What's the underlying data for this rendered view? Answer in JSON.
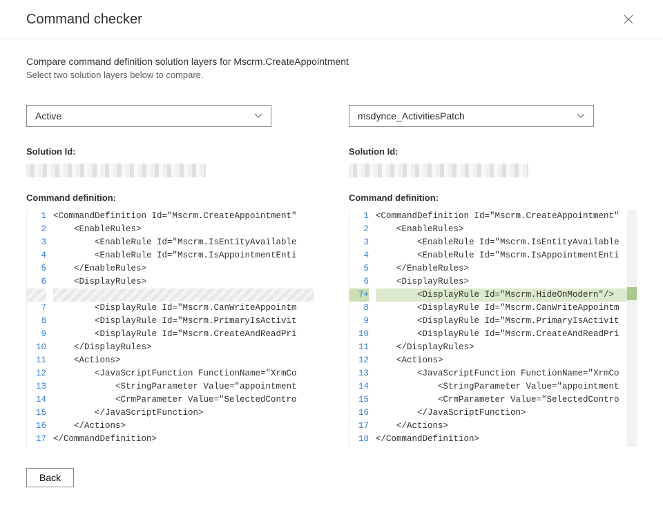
{
  "header": {
    "title": "Command checker"
  },
  "main": {
    "subtitle": "Compare command definition solution layers for Mscrm.CreateAppointment",
    "description": "Select two solution layers below to compare."
  },
  "labels": {
    "solution_id": "Solution Id:",
    "command_definition": "Command definition:"
  },
  "left": {
    "dropdown": "Active",
    "lines": [
      {
        "num": "1",
        "text": "<CommandDefinition Id=\"Mscrm.CreateAppointment\"",
        "type": "normal"
      },
      {
        "num": "2",
        "text": "    <EnableRules>",
        "type": "normal"
      },
      {
        "num": "3",
        "text": "        <EnableRule Id=\"Mscrm.IsEntityAvailable",
        "type": "normal"
      },
      {
        "num": "4",
        "text": "        <EnableRule Id=\"Mscrm.IsAppointmentEnti",
        "type": "normal"
      },
      {
        "num": "5",
        "text": "    </EnableRules>",
        "type": "normal"
      },
      {
        "num": "6",
        "text": "    <DisplayRules>",
        "type": "normal"
      },
      {
        "num": "",
        "text": "",
        "type": "hatched"
      },
      {
        "num": "7",
        "text": "        <DisplayRule Id=\"Mscrm.CanWriteAppointm",
        "type": "normal"
      },
      {
        "num": "8",
        "text": "        <DisplayRule Id=\"Mscrm.PrimaryIsActivit",
        "type": "normal"
      },
      {
        "num": "9",
        "text": "        <DisplayRule Id=\"Mscrm.CreateAndReadPri",
        "type": "normal"
      },
      {
        "num": "10",
        "text": "    </DisplayRules>",
        "type": "normal"
      },
      {
        "num": "11",
        "text": "    <Actions>",
        "type": "normal"
      },
      {
        "num": "12",
        "text": "        <JavaScriptFunction FunctionName=\"XrmCo",
        "type": "normal"
      },
      {
        "num": "13",
        "text": "            <StringParameter Value=\"appointment",
        "type": "normal"
      },
      {
        "num": "14",
        "text": "            <CrmParameter Value=\"SelectedContro",
        "type": "normal"
      },
      {
        "num": "15",
        "text": "        </JavaScriptFunction>",
        "type": "normal"
      },
      {
        "num": "16",
        "text": "    </Actions>",
        "type": "normal"
      },
      {
        "num": "17",
        "text": "</CommandDefinition>",
        "type": "normal"
      }
    ]
  },
  "right": {
    "dropdown": "msdynce_ActivitiesPatch",
    "lines": [
      {
        "num": "1",
        "text": "<CommandDefinition Id=\"Mscrm.CreateAppointment\"",
        "type": "normal"
      },
      {
        "num": "2",
        "text": "    <EnableRules>",
        "type": "normal"
      },
      {
        "num": "3",
        "text": "        <EnableRule Id=\"Mscrm.IsEntityAvailable",
        "type": "normal"
      },
      {
        "num": "4",
        "text": "        <EnableRule Id=\"Mscrm.IsAppointmentEnti",
        "type": "normal"
      },
      {
        "num": "5",
        "text": "    </EnableRules>",
        "type": "normal"
      },
      {
        "num": "6",
        "text": "    <DisplayRules>",
        "type": "normal"
      },
      {
        "num": "7+",
        "text": "        <DisplayRule Id=\"Mscrm.HideOnModern\"/>",
        "type": "added"
      },
      {
        "num": "8",
        "text": "        <DisplayRule Id=\"Mscrm.CanWriteAppointm",
        "type": "normal"
      },
      {
        "num": "9",
        "text": "        <DisplayRule Id=\"Mscrm.PrimaryIsActivit",
        "type": "normal"
      },
      {
        "num": "10",
        "text": "        <DisplayRule Id=\"Mscrm.CreateAndReadPri",
        "type": "normal"
      },
      {
        "num": "11",
        "text": "    </DisplayRules>",
        "type": "normal"
      },
      {
        "num": "12",
        "text": "    <Actions>",
        "type": "normal"
      },
      {
        "num": "13",
        "text": "        <JavaScriptFunction FunctionName=\"XrmCo",
        "type": "normal"
      },
      {
        "num": "14",
        "text": "            <StringParameter Value=\"appointment",
        "type": "normal"
      },
      {
        "num": "15",
        "text": "            <CrmParameter Value=\"SelectedContro",
        "type": "normal"
      },
      {
        "num": "16",
        "text": "        </JavaScriptFunction>",
        "type": "normal"
      },
      {
        "num": "17",
        "text": "    </Actions>",
        "type": "normal"
      },
      {
        "num": "18",
        "text": "</CommandDefinition>",
        "type": "normal"
      }
    ]
  },
  "footer": {
    "back": "Back"
  }
}
